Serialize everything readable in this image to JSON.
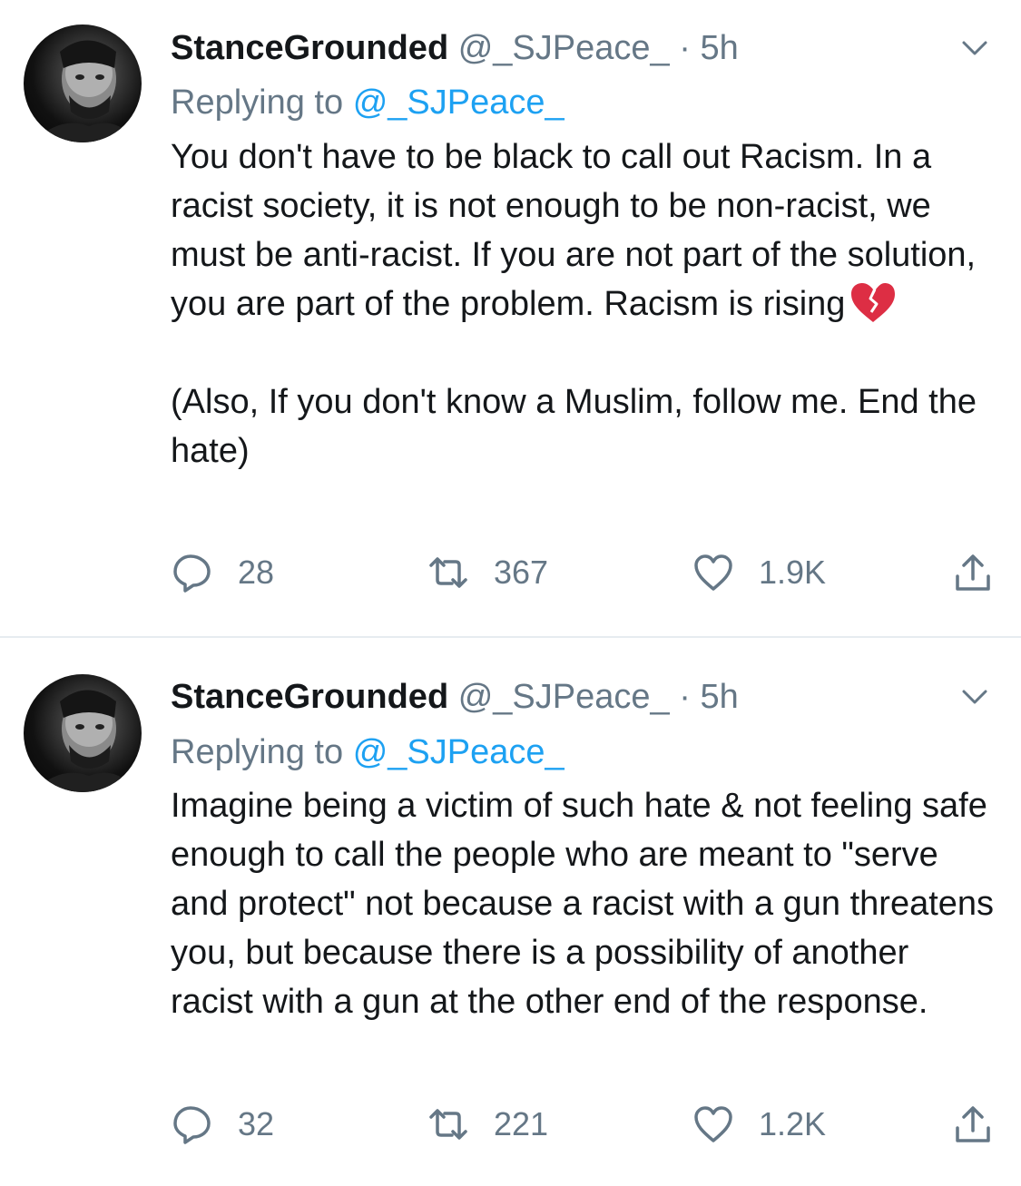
{
  "tweets": [
    {
      "display_name": "StanceGrounded",
      "handle": "@_SJPeace_",
      "separator": "·",
      "time": "5h",
      "replying_prefix": "Replying to",
      "replying_handle": "@_SJPeace_",
      "text": "You don't have to be black to call out Racism. In a racist society, it is not enough to be non-racist, we must be anti-racist. If you are not part of the solution, you are part of the problem. Racism is rising",
      "emoji": "broken-heart-icon",
      "text_2": "(Also, If you don't know a Muslim, follow me. End the hate)",
      "replies": "28",
      "retweets": "367",
      "likes": "1.9K"
    },
    {
      "display_name": "StanceGrounded",
      "handle": "@_SJPeace_",
      "separator": "·",
      "time": "5h",
      "replying_prefix": "Replying to",
      "replying_handle": "@_SJPeace_",
      "text": "Imagine being a victim of such hate & not feeling safe enough to call the people who are meant to \"serve and protect\" not because a racist with a gun threatens you, but because there is a possibility of another racist with a gun at the other end of the response.",
      "replies": "32",
      "retweets": "221",
      "likes": "1.2K"
    }
  ],
  "colors": {
    "text": "#14171a",
    "secondary": "#657786",
    "link": "#1da1f2",
    "divider": "#e6ecf0",
    "heart_emoji": "#dd2e44"
  }
}
